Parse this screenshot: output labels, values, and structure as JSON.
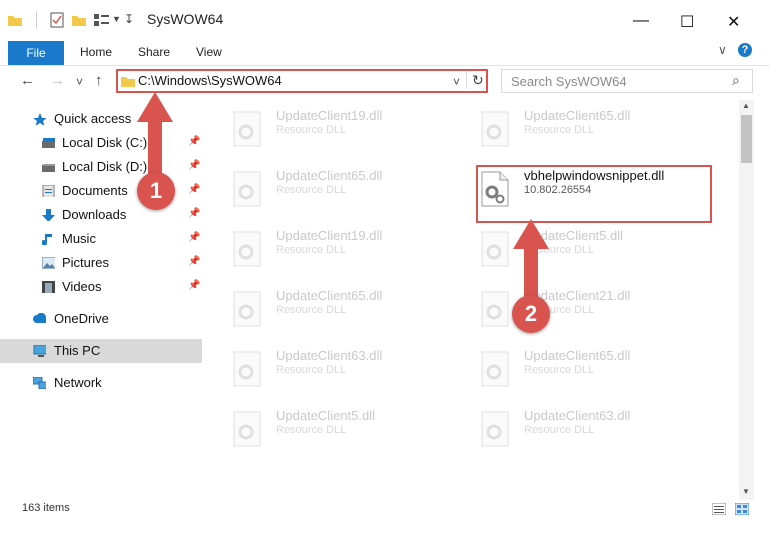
{
  "window": {
    "title": "SysWOW64",
    "minimize_glyph": "—",
    "maximize_glyph": "☐",
    "close_glyph": "✕"
  },
  "ribbon": {
    "file_label": "File",
    "tabs": [
      "Home",
      "Share",
      "View"
    ],
    "expand_glyph": "∨",
    "help_glyph": "?"
  },
  "nav": {
    "back_glyph": "←",
    "forward_glyph": "→",
    "recent_glyph": "˅",
    "up_glyph": "↑",
    "address": "C:\\Windows\\SysWOW64",
    "address_dropdown_glyph": "˅",
    "refresh_glyph": "↻",
    "search_placeholder": "Search SysWOW64",
    "search_glyph": "⌕"
  },
  "sidebar": {
    "quick_access": "Quick access",
    "items": [
      {
        "label": "Local Disk (C:)",
        "icon": "drive-icon"
      },
      {
        "label": "Local Disk (D:)",
        "icon": "drive-icon"
      },
      {
        "label": "Documents",
        "icon": "documents-icon"
      },
      {
        "label": "Downloads",
        "icon": "downloads-icon"
      },
      {
        "label": "Music",
        "icon": "music-icon"
      },
      {
        "label": "Pictures",
        "icon": "pictures-icon"
      },
      {
        "label": "Videos",
        "icon": "videos-icon"
      }
    ],
    "pin_glyph": "📌",
    "onedrive": "OneDrive",
    "this_pc": "This PC",
    "network": "Network"
  },
  "files": [
    {
      "name": "UpdateClient19.dll",
      "type": "Resource DLL"
    },
    {
      "name": "UpdateClient65.dll",
      "type": "Resource DLL"
    },
    {
      "name": "UpdateClient65.dll",
      "type": "Resource DLL"
    },
    {
      "name": "vbhelpwindowsnippet.dll",
      "type": "10.802.26554"
    },
    {
      "name": "UpdateClient19.dll",
      "type": "Resource DLL"
    },
    {
      "name": "UpdateClient5.dll",
      "type": "Resource DLL"
    },
    {
      "name": "UpdateClient65.dll",
      "type": "Resource DLL"
    },
    {
      "name": "UpdateClient21.dll",
      "type": "Resource DLL"
    },
    {
      "name": "UpdateClient63.dll",
      "type": "Resource DLL"
    },
    {
      "name": "UpdateClient65.dll",
      "type": "Resource DLL"
    },
    {
      "name": "UpdateClient5.dll",
      "type": "Resource DLL"
    },
    {
      "name": "UpdateClient63.dll",
      "type": "Resource DLL"
    }
  ],
  "annotations": {
    "step1": "1",
    "step2": "2"
  },
  "status": {
    "item_count": "163 items"
  },
  "colors": {
    "accent": "#1979ca",
    "annotation": "#d9534f",
    "folder": "#f2c94c"
  }
}
